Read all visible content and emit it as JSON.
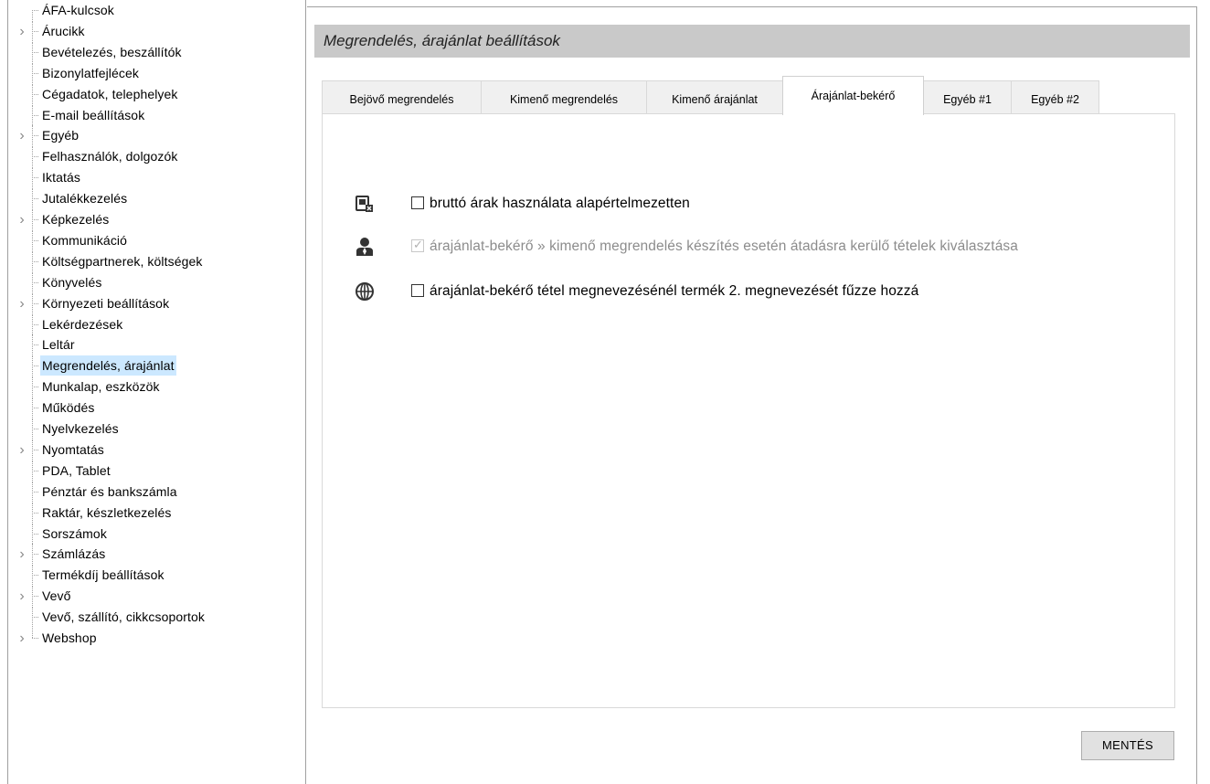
{
  "sidebar": {
    "items": [
      {
        "label": "ÁFA-kulcsok",
        "expandable": false,
        "selected": false
      },
      {
        "label": "Árucikk",
        "expandable": true,
        "selected": false
      },
      {
        "label": "Bevételezés, beszállítók",
        "expandable": false,
        "selected": false
      },
      {
        "label": "Bizonylatfejlécek",
        "expandable": false,
        "selected": false
      },
      {
        "label": "Cégadatok, telephelyek",
        "expandable": false,
        "selected": false
      },
      {
        "label": "E-mail beállítások",
        "expandable": false,
        "selected": false
      },
      {
        "label": "Egyéb",
        "expandable": true,
        "selected": false
      },
      {
        "label": "Felhasználók, dolgozók",
        "expandable": false,
        "selected": false
      },
      {
        "label": "Iktatás",
        "expandable": false,
        "selected": false
      },
      {
        "label": "Jutalékkezelés",
        "expandable": false,
        "selected": false
      },
      {
        "label": "Képkezelés",
        "expandable": true,
        "selected": false
      },
      {
        "label": "Kommunikáció",
        "expandable": false,
        "selected": false
      },
      {
        "label": "Költségpartnerek, költségek",
        "expandable": false,
        "selected": false
      },
      {
        "label": "Könyvelés",
        "expandable": false,
        "selected": false
      },
      {
        "label": "Környezeti beállítások",
        "expandable": true,
        "selected": false
      },
      {
        "label": "Lekérdezések",
        "expandable": false,
        "selected": false
      },
      {
        "label": "Leltár",
        "expandable": false,
        "selected": false
      },
      {
        "label": "Megrendelés, árajánlat",
        "expandable": false,
        "selected": true
      },
      {
        "label": "Munkalap, eszközök",
        "expandable": false,
        "selected": false
      },
      {
        "label": "Működés",
        "expandable": false,
        "selected": false
      },
      {
        "label": "Nyelvkezelés",
        "expandable": false,
        "selected": false
      },
      {
        "label": "Nyomtatás",
        "expandable": true,
        "selected": false
      },
      {
        "label": "PDA, Tablet",
        "expandable": false,
        "selected": false
      },
      {
        "label": "Pénztár és bankszámla",
        "expandable": false,
        "selected": false
      },
      {
        "label": "Raktár, készletkezelés",
        "expandable": false,
        "selected": false
      },
      {
        "label": "Sorszámok",
        "expandable": false,
        "selected": false
      },
      {
        "label": "Számlázás",
        "expandable": true,
        "selected": false
      },
      {
        "label": "Termékdíj beállítások",
        "expandable": false,
        "selected": false
      },
      {
        "label": "Vevő",
        "expandable": true,
        "selected": false
      },
      {
        "label": "Vevő, szállító, cikkcsoportok",
        "expandable": false,
        "selected": false
      },
      {
        "label": "Webshop",
        "expandable": true,
        "selected": false
      }
    ]
  },
  "main": {
    "title": "Megrendelés, árajánlat beállítások",
    "tabs": [
      {
        "label": "Bejövő megrendelés",
        "active": false
      },
      {
        "label": "Kimenő megrendelés",
        "active": false
      },
      {
        "label": "Kimenő árajánlat",
        "active": false
      },
      {
        "label": "Árajánlat-bekérő",
        "active": true
      },
      {
        "label": "Egyéb #1",
        "active": false
      },
      {
        "label": "Egyéb #2",
        "active": false
      }
    ],
    "options": [
      {
        "icon": "price-tag-icon",
        "label": "bruttó árak használata alapértelmezetten",
        "checked": false,
        "enabled": true
      },
      {
        "icon": "user-icon",
        "label": "árajánlat-bekérő » kimenő megrendelés készítés esetén átadásra kerülő tételek kiválasztása",
        "checked": true,
        "enabled": false
      },
      {
        "icon": "globe-icon",
        "label": "árajánlat-bekérő tétel megnevezésénél termék 2. megnevezését fűzze hozzá",
        "checked": false,
        "enabled": true
      }
    ],
    "save_label": "MENTÉS"
  },
  "colors": {
    "selected_highlight": "#cce8ff",
    "title_bar": "#c9c9c9",
    "border": "#a0a0a0"
  }
}
